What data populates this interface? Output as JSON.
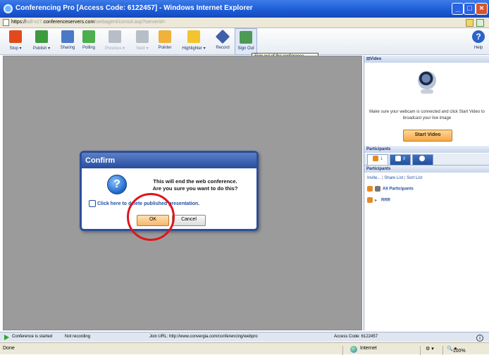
{
  "window": {
    "title": "Conferencing Pro [Access Code: 6122457] - Windows Internet Explorer",
    "buttons": [
      "_",
      "□",
      "×"
    ]
  },
  "address": {
    "url_prefix": "https://",
    "url_faint1": "adl-cc7.",
    "url_main": "conferenceservers.com",
    "url_faint2": "/webagent/consol.asp?serverid="
  },
  "toolbar": {
    "items": [
      {
        "label": "Stop",
        "icon": "stop-icon",
        "color": "#e34a1b",
        "dropdown": true,
        "enabled": true
      },
      {
        "label": "Publish",
        "icon": "publish-icon",
        "color": "#3d9a3d",
        "dropdown": true,
        "enabled": true
      },
      {
        "label": "Sharing",
        "icon": "sharing-icon",
        "color": "#4a79c7",
        "dropdown": false,
        "enabled": true
      },
      {
        "label": "Polling",
        "icon": "polling-icon",
        "color": "#4cae4c",
        "dropdown": false,
        "enabled": true
      },
      {
        "label": "Previous",
        "icon": "previous-icon",
        "color": "#b8bec8",
        "dropdown": true,
        "enabled": false
      },
      {
        "label": "Next",
        "icon": "next-icon",
        "color": "#b8bec8",
        "dropdown": true,
        "enabled": false
      },
      {
        "label": "Pointer",
        "icon": "pointer-icon",
        "color": "#f0b23a",
        "dropdown": false,
        "enabled": true
      },
      {
        "label": "Highlighter",
        "icon": "highlighter-icon",
        "color": "#f2c52e",
        "dropdown": true,
        "enabled": true
      },
      {
        "label": "Record",
        "icon": "record-icon",
        "color": "#3f5fa8",
        "dropdown": false,
        "enabled": true
      },
      {
        "label": "Sign Out",
        "icon": "sign-out-icon",
        "color": "#4d9a56",
        "dropdown": false,
        "enabled": true
      }
    ],
    "help_label": "Help",
    "tooltip": "Sign out of the conference"
  },
  "video_panel": {
    "header": "⊟Video",
    "message": "Make sure your webcam is connected and click Start Video to broadcast your live image",
    "start_button": "Start Video"
  },
  "participants_panel": {
    "header": "Participants",
    "tabs": [
      {
        "label": "1",
        "icon": "participants-icon",
        "active": true
      },
      {
        "label": "0",
        "icon": "chat-icon",
        "active": false
      },
      {
        "label": "",
        "icon": "questions-icon",
        "active": false
      }
    ],
    "subheader": "Participants",
    "links": [
      "Invite...",
      "Share List",
      "Sort List"
    ],
    "group": "All Participants",
    "users": [
      {
        "name": "RRR"
      }
    ]
  },
  "dialog": {
    "title": "Confirm",
    "message_line1": "This will end the web conference.",
    "message_line2": "Are you sure you want to do this?",
    "link": "Click here to delete published presentation.",
    "ok": "OK",
    "cancel": "Cancel",
    "highlight_color": "#e0151b"
  },
  "app_status": {
    "state": "Conference is started",
    "recording": "Not recording",
    "join_url": "Join URL: http://www.convergia.com/conferencing/webpro",
    "access_code": "Access Code: 6122457"
  },
  "ie_status": {
    "left": "Done",
    "zone": "Internet",
    "zoom": "100%"
  }
}
